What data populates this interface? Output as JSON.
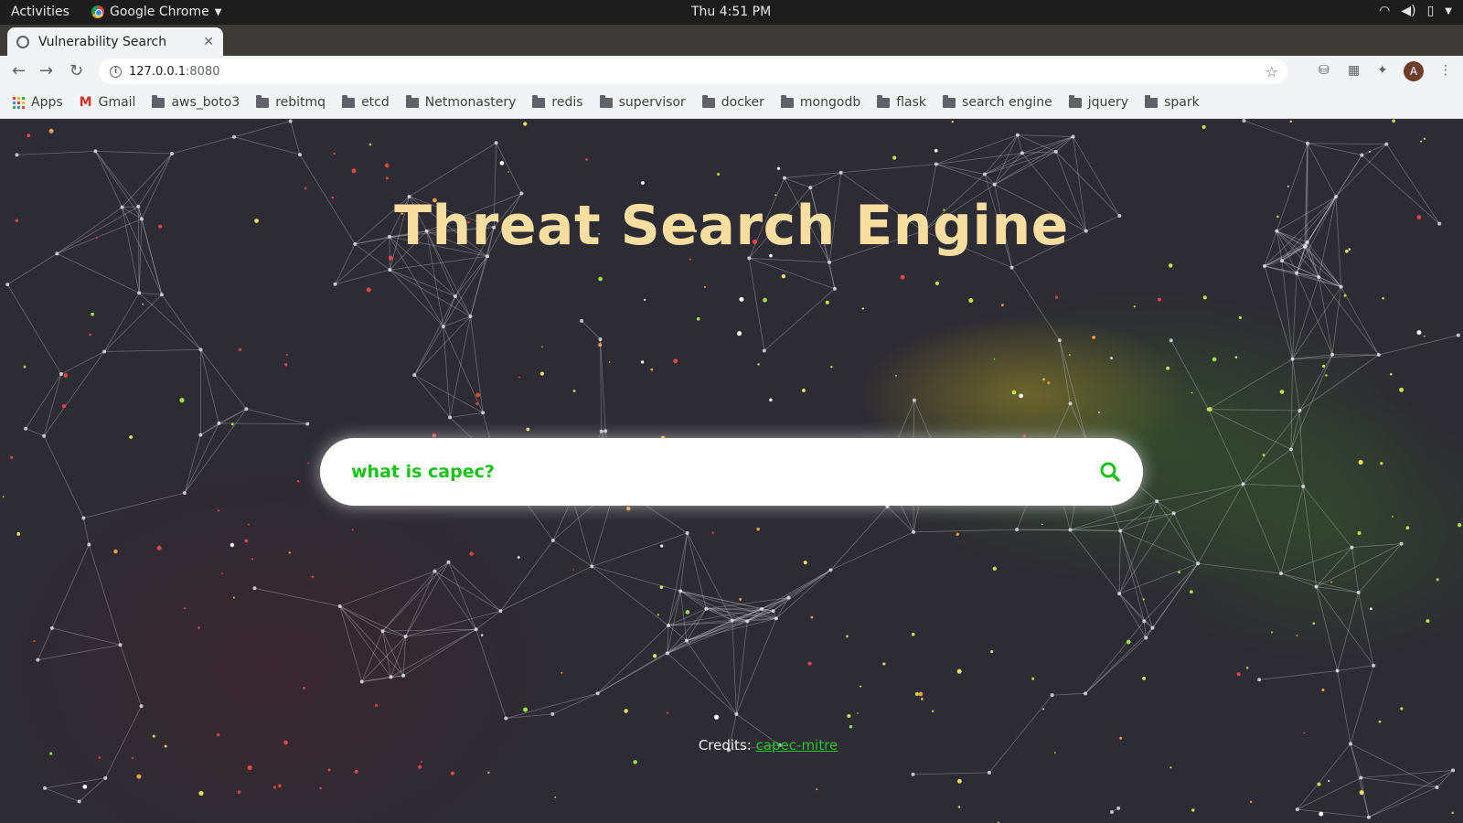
{
  "system": {
    "activities": "Activities",
    "app_name": "Google Chrome",
    "clock": "Thu  4:51 PM"
  },
  "browser": {
    "tab_title": "Vulnerability Search",
    "url_host": "127.0.0.1",
    "url_port": ":8080",
    "avatar_initial": "A"
  },
  "bookmarks": {
    "apps": "Apps",
    "gmail": "Gmail",
    "folders": [
      "aws_boto3",
      "rebitmq",
      "etcd",
      "Netmonastery",
      "redis",
      "supervisor",
      "docker",
      "mongodb",
      "flask",
      "search engine",
      "jquery",
      "spark"
    ]
  },
  "page": {
    "title": "Threat Search Engine",
    "search_value": "what is capec?",
    "credits_label": "Credits:",
    "credits_link": "capec-mitre"
  },
  "colors": {
    "title": "#f7dda0",
    "search_text": "#19c219",
    "link": "#22c522",
    "background": "#2d2b33"
  }
}
